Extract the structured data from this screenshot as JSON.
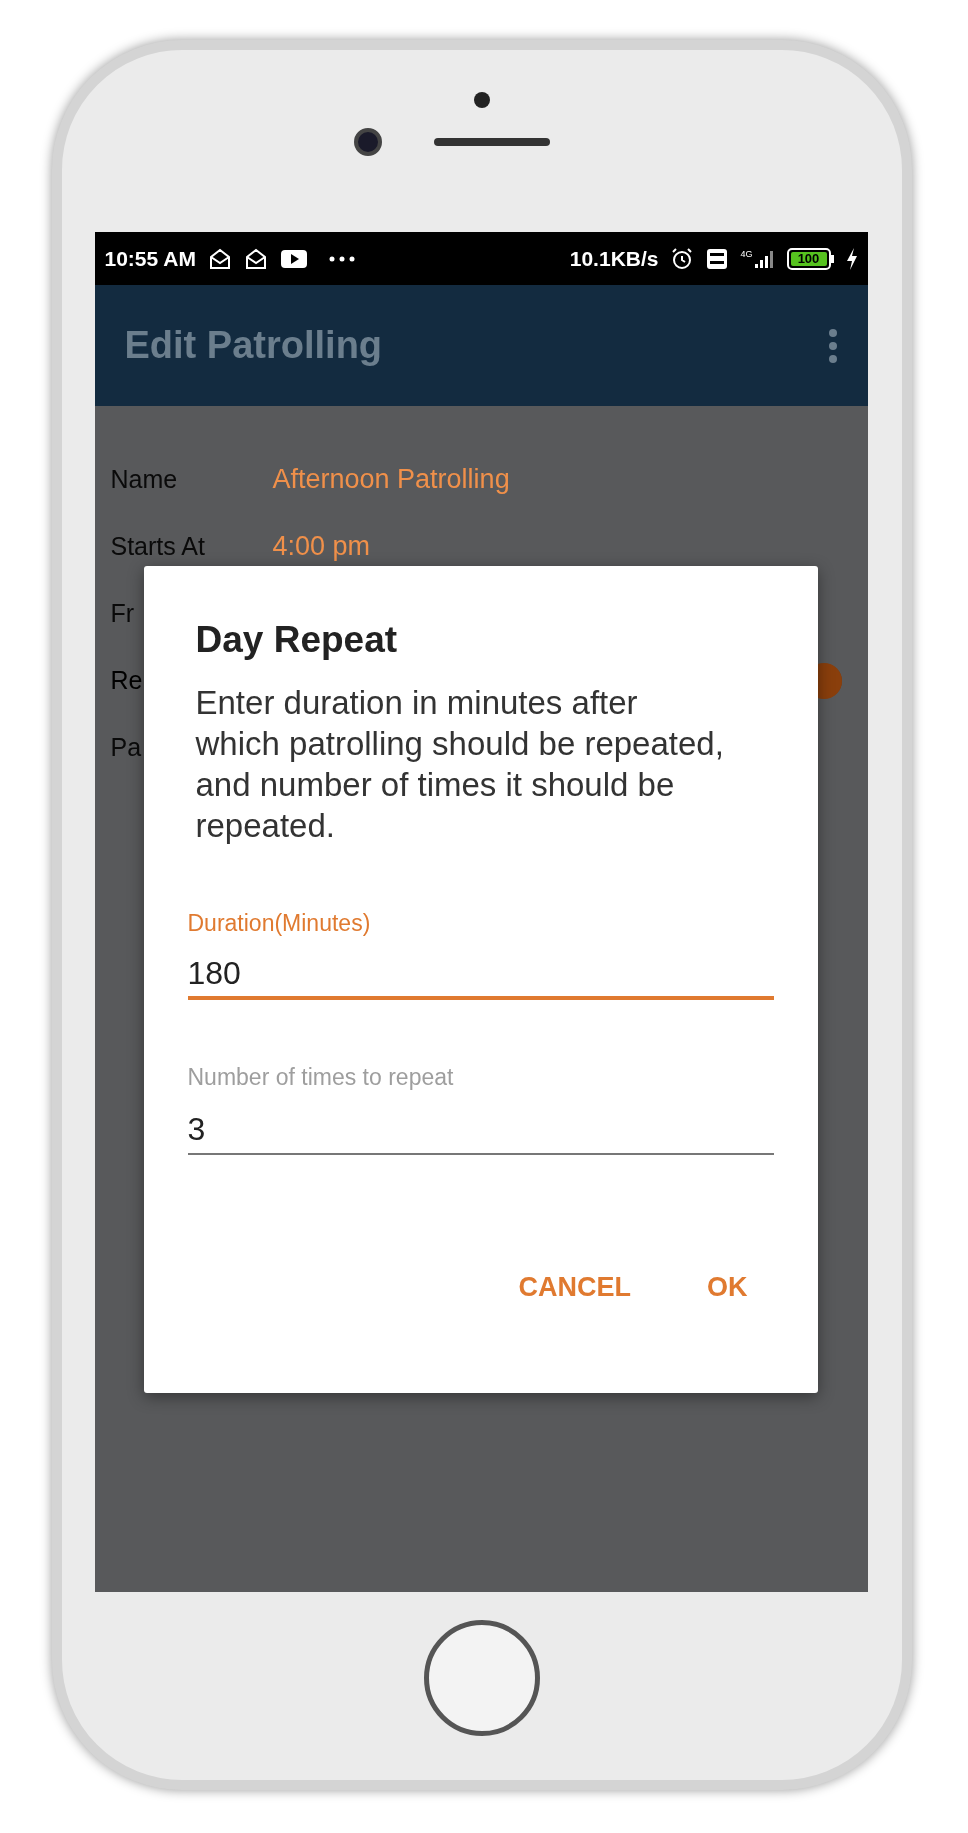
{
  "status_bar": {
    "time": "10:55 AM",
    "speed": "10.1KB/s",
    "network_type": "4G",
    "battery": "100"
  },
  "app_bar": {
    "title": "Edit Patrolling"
  },
  "fields": [
    {
      "label": "Name",
      "value": "Afternoon Patrolling",
      "kind": "value"
    },
    {
      "label": "Starts At",
      "value": "4:00 pm",
      "kind": "value"
    },
    {
      "label": "Fr",
      "kind": "plain"
    },
    {
      "label": "Re",
      "kind": "switch",
      "on": true
    },
    {
      "label": "Pa",
      "kind": "plain"
    }
  ],
  "dialog": {
    "title": "Day Repeat",
    "message_lines": [
      "Enter duration in minutes after",
      "which patrolling should be repeated,",
      "and number of times it should be",
      "repeated."
    ],
    "inputs": [
      {
        "label": "Duration(Minutes)",
        "value": "180",
        "focused": true
      },
      {
        "label": "Number of times to repeat",
        "value": "3",
        "focused": false
      }
    ],
    "buttons": [
      "CANCEL",
      "OK"
    ]
  }
}
